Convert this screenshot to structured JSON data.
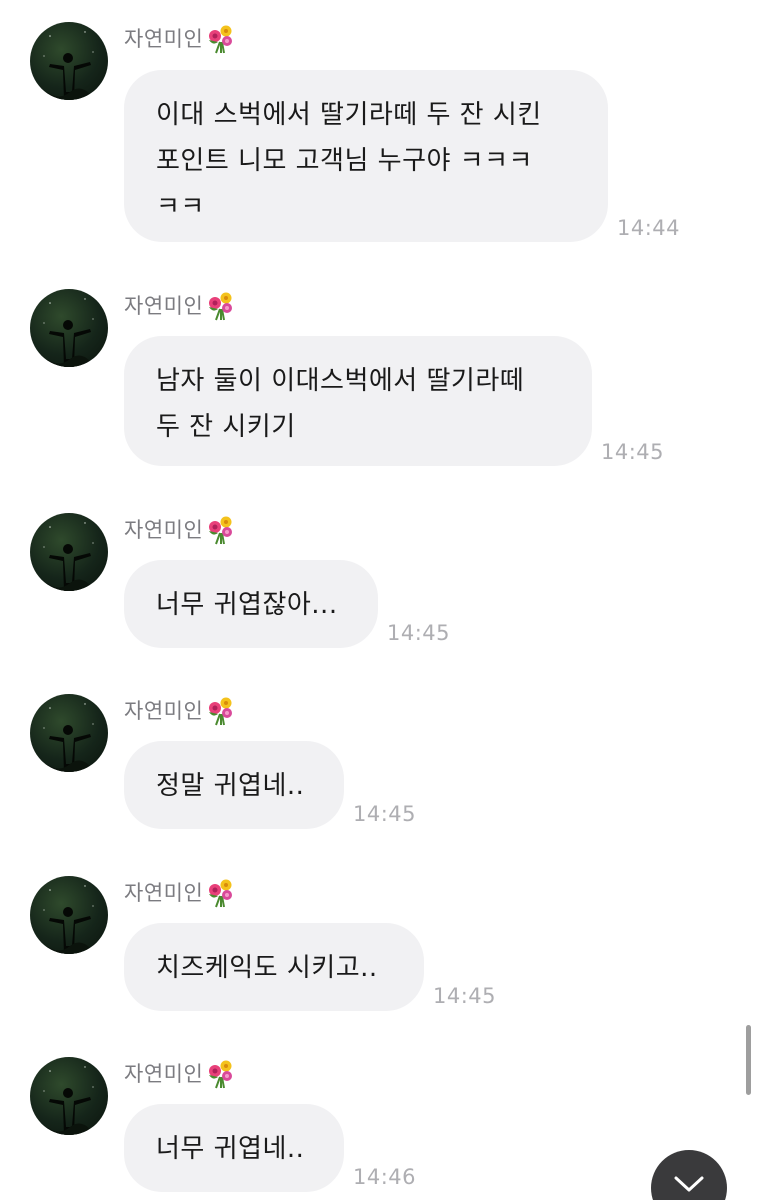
{
  "messages": [
    {
      "sender": "자연미인",
      "sender_badge": "bouquet-icon",
      "text": "이대 스벅에서 딸기라떼 두 잔 시킨\n포인트 니모 고객님 누구야 ㅋㅋㅋ\nㅋㅋ",
      "time": "14:44"
    },
    {
      "sender": "자연미인",
      "sender_badge": "bouquet-icon",
      "text": "남자 둘이 이대스벅에서 딸기라떼\n두 잔 시키기",
      "time": "14:45"
    },
    {
      "sender": "자연미인",
      "sender_badge": "bouquet-icon",
      "text": "너무 귀엽잖아...",
      "time": "14:45"
    },
    {
      "sender": "자연미인",
      "sender_badge": "bouquet-icon",
      "text": "정말 귀엽네..",
      "time": "14:45"
    },
    {
      "sender": "자연미인",
      "sender_badge": "bouquet-icon",
      "text": "치즈케익도 시키고..",
      "time": "14:45"
    },
    {
      "sender": "자연미인",
      "sender_badge": "bouquet-icon",
      "text": "너무 귀엽네..",
      "time": "14:46"
    }
  ],
  "controls": {
    "scroll_down_icon": "chevron-down-icon"
  }
}
